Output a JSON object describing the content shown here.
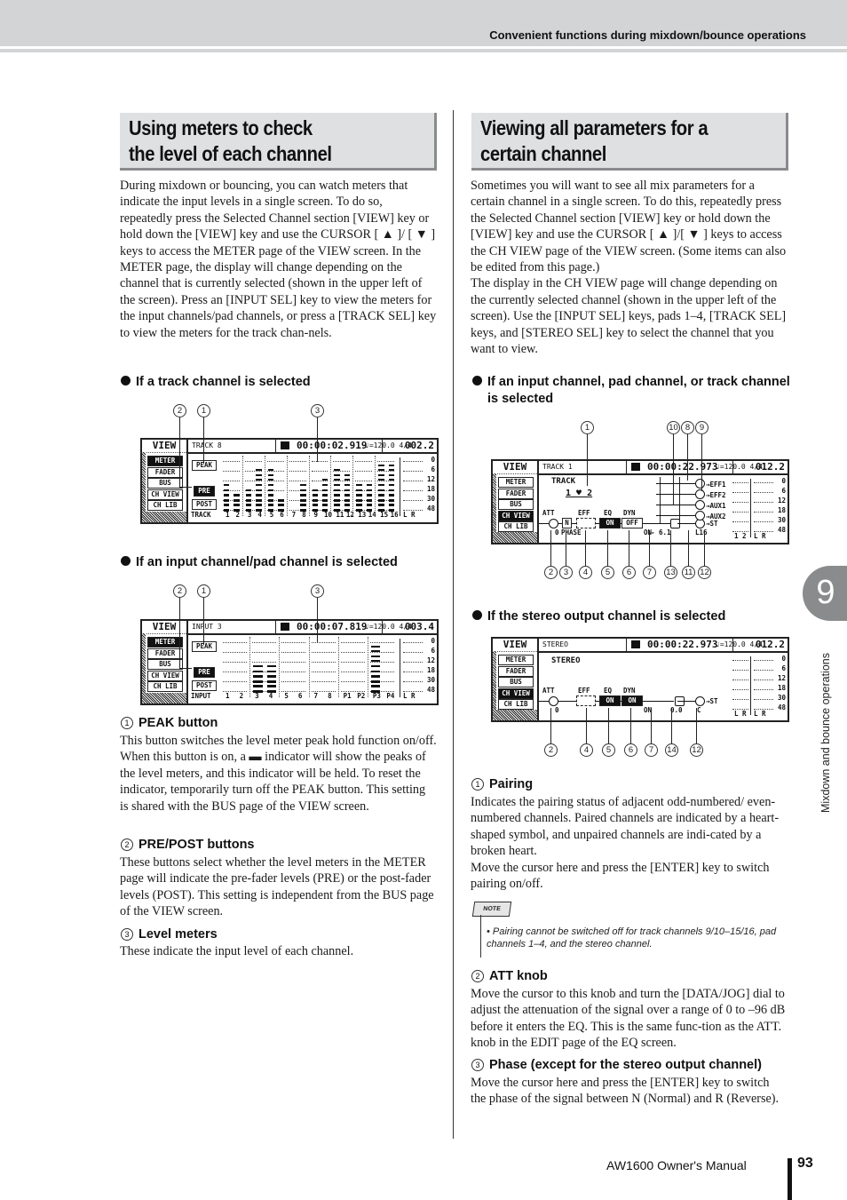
{
  "header": {
    "running_head": "Convenient functions during mixdown/bounce operations"
  },
  "left": {
    "title": [
      "Using meters to check",
      "the level of each channel"
    ],
    "intro": "During mixdown or bouncing, you can watch meters that indicate the input levels in a single screen. To do so, repeatedly press the Selected Channel section [VIEW] key or hold down the [VIEW] key and use the CURSOR [ ▲ ]/ [ ▼ ] keys to access the METER page of the VIEW screen. In the METER page, the display will change depending on the channel that is currently selected (shown in the upper left of the screen). Press an [INPUT SEL] key to view the meters for the input channels/pad channels, or press a [TRACK SEL] key to view the meters for the track chan-nels.",
    "case1": "If a track channel is selected",
    "case2": "If an input channel/pad channel is selected",
    "items": [
      {
        "num": "1",
        "head": "PEAK button",
        "text": "This button switches the level meter peak hold function on/off. When this button is on, a ▬ indicator will show the peaks of the level meters, and this indicator will be held. To reset the indicator, temporarily turn off the PEAK button. This setting is shared with the BUS page of the VIEW screen."
      },
      {
        "num": "2",
        "head": "PRE/POST buttons",
        "text": "These buttons select whether the level meters in the METER page will indicate the pre-fader levels (PRE) or the post-fader levels (POST). This setting is independent from the BUS page of the VIEW screen."
      },
      {
        "num": "3",
        "head": "Level meters",
        "text": "These indicate the input level of each channel."
      }
    ]
  },
  "right": {
    "title": [
      "Viewing all parameters for a",
      "certain channel"
    ],
    "intro1": "Sometimes you will want to see all mix parameters for a certain channel in a single screen. To do this, repeatedly press the Selected Channel section [VIEW] key or hold down the [VIEW] key and use the CURSOR [ ▲ ]/[ ▼ ] keys to access the CH VIEW page of the VIEW screen. (Some items can also be edited from this page.)",
    "intro2": "The display in the CH VIEW page will change depending on the currently selected channel (shown in the upper left of the screen). Use the [INPUT SEL] keys, pads 1–4, [TRACK SEL] keys, and [STEREO SEL] key to select the channel that you want to view.",
    "case1": "If an input channel, pad channel, or track channel is selected",
    "case2": "If the stereo output channel is selected",
    "items": [
      {
        "num": "1",
        "head": "Pairing",
        "text": "Indicates the pairing status of adjacent odd-numbered/ even-numbered channels. Paired channels are indicated by a heart-shaped symbol, and unpaired channels are indi-cated by a broken heart.",
        "text2": "Move the cursor here and press the [ENTER] key to switch pairing on/off."
      },
      {
        "num": "2",
        "head": "ATT knob",
        "text": "Move the cursor to this knob and turn the [DATA/JOG] dial to adjust the attenuation of the signal over a range of 0 to –96 dB before it enters the EQ. This is the same func-tion as the ATT. knob in the EDIT page of the EQ screen."
      },
      {
        "num": "3",
        "head": "Phase (except for the stereo output channel)",
        "text": "Move the cursor here and press the [ENTER] key to switch the phase of the signal between N (Normal) and R (Reverse)."
      }
    ],
    "note_label": "NOTE",
    "note": "• Pairing cannot be switched off for track channels 9/10–15/16, pad channels 1–4, and the stereo channel."
  },
  "screens": {
    "tabs": [
      "METER",
      "FADER",
      "BUS",
      "CH VIEW",
      "CH LIB"
    ],
    "view_label": "VIEW",
    "tempo": "♩=120.0 4/4",
    "scale": [
      "0",
      "6",
      "12",
      "18",
      "30",
      "48"
    ],
    "meter_track": {
      "channel": "TRACK 8",
      "time": "00:00:02.919",
      "measure": "002.2",
      "peak": "PEAK",
      "pre": "PRE",
      "post": "POST",
      "row_label": "TRACK",
      "channels": [
        "1",
        "2",
        "3",
        "4",
        "5",
        "6",
        "7",
        "8",
        "9",
        "10",
        "11",
        "12",
        "13",
        "14",
        "15",
        "16"
      ],
      "stereo": "L R",
      "levels": [
        6,
        4,
        5,
        9,
        9,
        3,
        0,
        6,
        5,
        7,
        9,
        8,
        6,
        6,
        10,
        10
      ]
    },
    "meter_input": {
      "channel": "INPUT 3",
      "time": "00:00:07.819",
      "measure": "003.4",
      "peak": "PEAK",
      "pre": "PRE",
      "post": "POST",
      "row_label": "INPUT",
      "channels": [
        "1",
        "2",
        "3",
        "4",
        "5",
        "6",
        "7",
        "8",
        "P1",
        "P2",
        "P3",
        "P4"
      ],
      "stereo": "L R",
      "levels": [
        0,
        0,
        6,
        6,
        0,
        0,
        0,
        0,
        0,
        0,
        10,
        0
      ]
    },
    "chview_track": {
      "channel": "TRACK 1",
      "time": "00:00:22.973",
      "measure": "012.2",
      "name": "TRACK",
      "pair": "1 ♥ 2",
      "att": "ATT",
      "eff": "EFF",
      "eq": "EQ",
      "dyn": "DYN",
      "eq_val": "ON",
      "dyn_val": "OFF",
      "phase_val": "N",
      "att_val": "0",
      "phase": "PHASE",
      "on": "ON",
      "fader_val": "- 6.1",
      "pan": "L16",
      "sends": [
        "→EFF1",
        "→EFF2",
        "→AUX1",
        "→AUX2",
        "→ST"
      ],
      "ch_label": "1 2",
      "stereo": "L R"
    },
    "chview_stereo": {
      "channel": "STEREO",
      "time": "00:00:22.973",
      "measure": "012.2",
      "name": "STEREO",
      "att": "ATT",
      "eff": "EFF",
      "eq": "EQ",
      "dyn": "DYN",
      "eq_val": "ON",
      "dyn_val": "ON",
      "att_val": "0",
      "on": "ON",
      "fader_val": "0.0",
      "pan": "C",
      "send": "→ST",
      "ch_label": "L R",
      "stereo": "L R"
    },
    "callouts_meter": [
      "2",
      "1",
      "3"
    ],
    "callouts_chview_top": [
      "1",
      "10",
      "8",
      "9"
    ],
    "callouts_chview_bottom": [
      "2",
      "3",
      "4",
      "5",
      "6",
      "7",
      "13",
      "11",
      "12"
    ],
    "callouts_stereo_bottom": [
      "2",
      "4",
      "5",
      "6",
      "7",
      "14",
      "12"
    ]
  },
  "chapter": {
    "number": "9",
    "label": "Mixdown and bounce operations"
  },
  "footer": {
    "manual": "AW1600  Owner's Manual",
    "page": "93"
  }
}
